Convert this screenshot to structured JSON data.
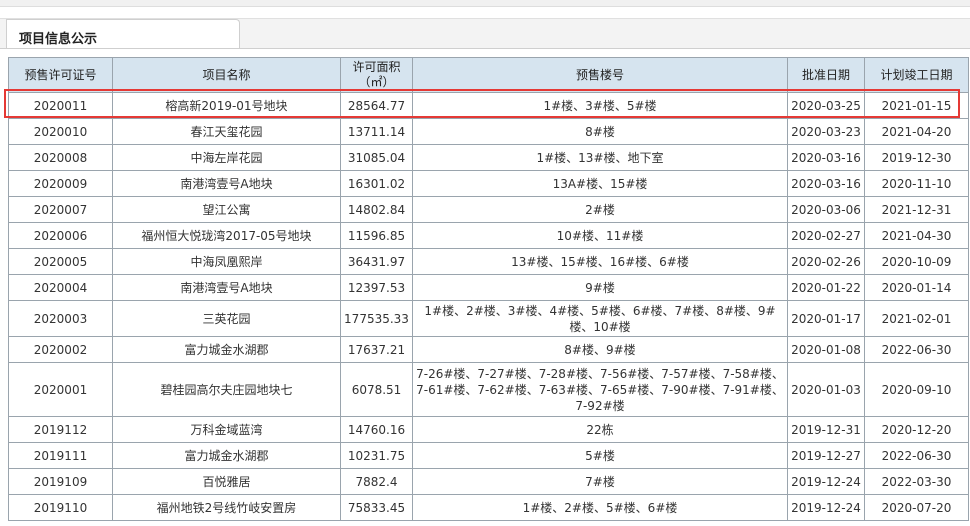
{
  "tab": {
    "title": "项目信息公示"
  },
  "columns": [
    "预售许可证号",
    "项目名称",
    "许可面积（㎡）",
    "预售楼号",
    "批准日期",
    "计划竣工日期"
  ],
  "rows": [
    {
      "permit": "2020011",
      "name": "榕高新2019-01号地块",
      "area": "28564.77",
      "buildings": "1#楼、3#楼、5#楼",
      "approved": "2020-03-25",
      "completion": "2021-01-15"
    },
    {
      "permit": "2020010",
      "name": "春江天玺花园",
      "area": "13711.14",
      "buildings": "8#楼",
      "approved": "2020-03-23",
      "completion": "2021-04-20"
    },
    {
      "permit": "2020008",
      "name": "中海左岸花园",
      "area": "31085.04",
      "buildings": "1#楼、13#楼、地下室",
      "approved": "2020-03-16",
      "completion": "2019-12-30"
    },
    {
      "permit": "2020009",
      "name": "南港湾壹号A地块",
      "area": "16301.02",
      "buildings": "13A#楼、15#楼",
      "approved": "2020-03-16",
      "completion": "2020-11-10"
    },
    {
      "permit": "2020007",
      "name": "望江公寓",
      "area": "14802.84",
      "buildings": "2#楼",
      "approved": "2020-03-06",
      "completion": "2021-12-31"
    },
    {
      "permit": "2020006",
      "name": "福州恒大悦珑湾2017-05号地块",
      "area": "11596.85",
      "buildings": "10#楼、11#楼",
      "approved": "2020-02-27",
      "completion": "2021-04-30"
    },
    {
      "permit": "2020005",
      "name": "中海凤凰熙岸",
      "area": "36431.97",
      "buildings": "13#楼、15#楼、16#楼、6#楼",
      "approved": "2020-02-26",
      "completion": "2020-10-09"
    },
    {
      "permit": "2020004",
      "name": "南港湾壹号A地块",
      "area": "12397.53",
      "buildings": "9#楼",
      "approved": "2020-01-22",
      "completion": "2020-01-14"
    },
    {
      "permit": "2020003",
      "name": "三英花园",
      "area": "177535.33",
      "buildings": "1#楼、2#楼、3#楼、4#楼、5#楼、6#楼、7#楼、8#楼、9#楼、10#楼",
      "approved": "2020-01-17",
      "completion": "2021-02-01"
    },
    {
      "permit": "2020002",
      "name": "富力城金水湖郡",
      "area": "17637.21",
      "buildings": "8#楼、9#楼",
      "approved": "2020-01-08",
      "completion": "2022-06-30"
    },
    {
      "permit": "2020001",
      "name": "碧桂园高尔夫庄园地块七",
      "area": "6078.51",
      "buildings": "7-26#楼、7-27#楼、7-28#楼、7-56#楼、7-57#楼、7-58#楼、7-61#楼、7-62#楼、7-63#楼、7-65#楼、7-90#楼、7-91#楼、7-92#楼",
      "approved": "2020-01-03",
      "completion": "2020-09-10"
    },
    {
      "permit": "2019112",
      "name": "万科金域蓝湾",
      "area": "14760.16",
      "buildings": "22栋",
      "approved": "2019-12-31",
      "completion": "2020-12-20"
    },
    {
      "permit": "2019111",
      "name": "富力城金水湖郡",
      "area": "10231.75",
      "buildings": "5#楼",
      "approved": "2019-12-27",
      "completion": "2022-06-30"
    },
    {
      "permit": "2019109",
      "name": "百悦雅居",
      "area": "7882.4",
      "buildings": "7#楼",
      "approved": "2019-12-24",
      "completion": "2022-03-30"
    },
    {
      "permit": "2019110",
      "name": "福州地铁2号线竹岐安置房",
      "area": "75833.45",
      "buildings": "1#楼、2#楼、5#楼、6#楼",
      "approved": "2019-12-24",
      "completion": "2020-07-20"
    }
  ]
}
